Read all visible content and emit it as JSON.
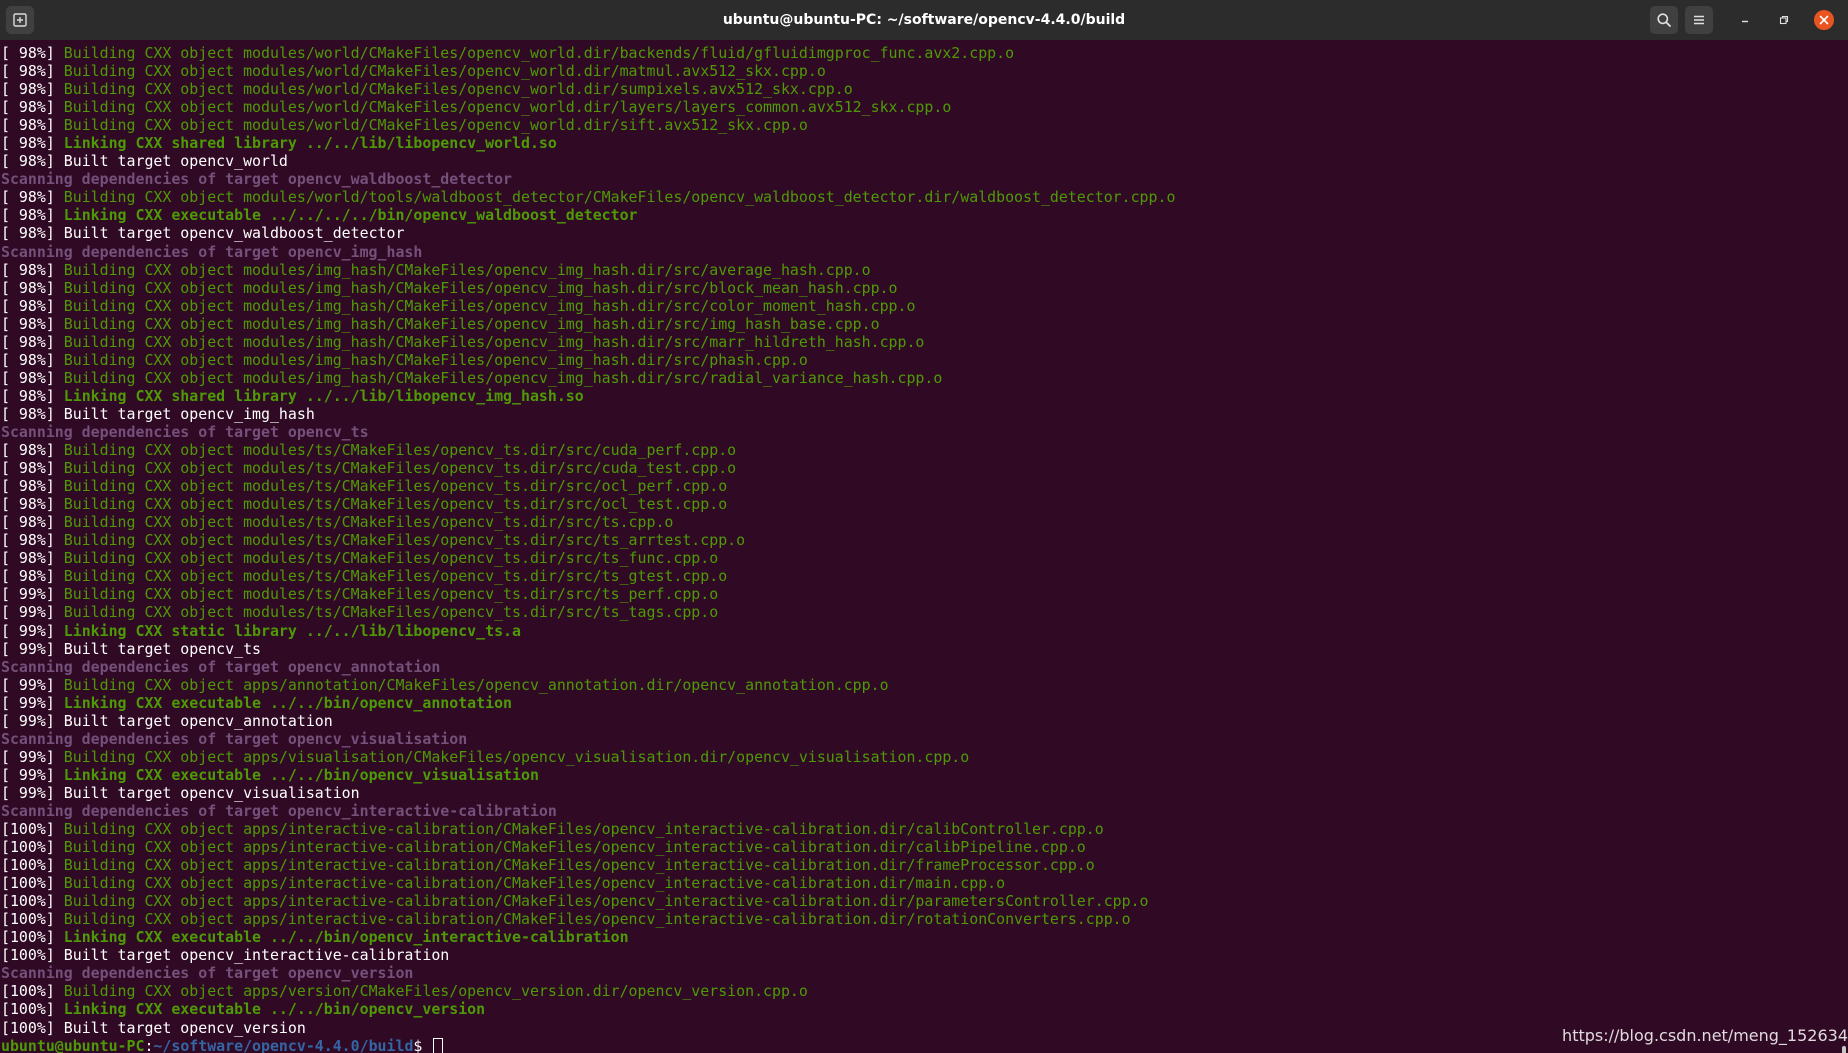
{
  "window": {
    "title": "ubuntu@ubuntu-PC: ~/software/opencv-4.4.0/build"
  },
  "titlebar_icons": {
    "new_tab": "new-tab-icon",
    "search": "search-icon",
    "menu": "hamburger-menu-icon",
    "minimize": "minimize-icon",
    "maximize": "maximize-icon",
    "close": "close-icon"
  },
  "colors": {
    "background": "#300a24",
    "titlebar": "#2c2c2c",
    "building": "#4e9a06",
    "scanning": "#75507b",
    "prompt_path": "#3465a4",
    "close_button": "#e95420"
  },
  "terminal": {
    "lines": [
      {
        "pct": "[ 98%]",
        "type": "building",
        "text": "Building CXX object modules/world/CMakeFiles/opencv_world.dir/backends/fluid/gfluidimgproc_func.avx2.cpp.o"
      },
      {
        "pct": "[ 98%]",
        "type": "building",
        "text": "Building CXX object modules/world/CMakeFiles/opencv_world.dir/matmul.avx512_skx.cpp.o"
      },
      {
        "pct": "[ 98%]",
        "type": "building",
        "text": "Building CXX object modules/world/CMakeFiles/opencv_world.dir/sumpixels.avx512_skx.cpp.o"
      },
      {
        "pct": "[ 98%]",
        "type": "building",
        "text": "Building CXX object modules/world/CMakeFiles/opencv_world.dir/layers/layers_common.avx512_skx.cpp.o"
      },
      {
        "pct": "[ 98%]",
        "type": "building",
        "text": "Building CXX object modules/world/CMakeFiles/opencv_world.dir/sift.avx512_skx.cpp.o"
      },
      {
        "pct": "[ 98%]",
        "type": "linking",
        "text": "Linking CXX shared library ../../lib/libopencv_world.so"
      },
      {
        "pct": "[ 98%]",
        "type": "built",
        "text": "Built target opencv_world"
      },
      {
        "pct": "",
        "type": "scanning",
        "text": "Scanning dependencies of target opencv_waldboost_detector"
      },
      {
        "pct": "[ 98%]",
        "type": "building",
        "text": "Building CXX object modules/world/tools/waldboost_detector/CMakeFiles/opencv_waldboost_detector.dir/waldboost_detector.cpp.o"
      },
      {
        "pct": "[ 98%]",
        "type": "linking",
        "text": "Linking CXX executable ../../../../bin/opencv_waldboost_detector"
      },
      {
        "pct": "[ 98%]",
        "type": "built",
        "text": "Built target opencv_waldboost_detector"
      },
      {
        "pct": "",
        "type": "scanning",
        "text": "Scanning dependencies of target opencv_img_hash"
      },
      {
        "pct": "[ 98%]",
        "type": "building",
        "text": "Building CXX object modules/img_hash/CMakeFiles/opencv_img_hash.dir/src/average_hash.cpp.o"
      },
      {
        "pct": "[ 98%]",
        "type": "building",
        "text": "Building CXX object modules/img_hash/CMakeFiles/opencv_img_hash.dir/src/block_mean_hash.cpp.o"
      },
      {
        "pct": "[ 98%]",
        "type": "building",
        "text": "Building CXX object modules/img_hash/CMakeFiles/opencv_img_hash.dir/src/color_moment_hash.cpp.o"
      },
      {
        "pct": "[ 98%]",
        "type": "building",
        "text": "Building CXX object modules/img_hash/CMakeFiles/opencv_img_hash.dir/src/img_hash_base.cpp.o"
      },
      {
        "pct": "[ 98%]",
        "type": "building",
        "text": "Building CXX object modules/img_hash/CMakeFiles/opencv_img_hash.dir/src/marr_hildreth_hash.cpp.o"
      },
      {
        "pct": "[ 98%]",
        "type": "building",
        "text": "Building CXX object modules/img_hash/CMakeFiles/opencv_img_hash.dir/src/phash.cpp.o"
      },
      {
        "pct": "[ 98%]",
        "type": "building",
        "text": "Building CXX object modules/img_hash/CMakeFiles/opencv_img_hash.dir/src/radial_variance_hash.cpp.o"
      },
      {
        "pct": "[ 98%]",
        "type": "linking",
        "text": "Linking CXX shared library ../../lib/libopencv_img_hash.so"
      },
      {
        "pct": "[ 98%]",
        "type": "built",
        "text": "Built target opencv_img_hash"
      },
      {
        "pct": "",
        "type": "scanning",
        "text": "Scanning dependencies of target opencv_ts"
      },
      {
        "pct": "[ 98%]",
        "type": "building",
        "text": "Building CXX object modules/ts/CMakeFiles/opencv_ts.dir/src/cuda_perf.cpp.o"
      },
      {
        "pct": "[ 98%]",
        "type": "building",
        "text": "Building CXX object modules/ts/CMakeFiles/opencv_ts.dir/src/cuda_test.cpp.o"
      },
      {
        "pct": "[ 98%]",
        "type": "building",
        "text": "Building CXX object modules/ts/CMakeFiles/opencv_ts.dir/src/ocl_perf.cpp.o"
      },
      {
        "pct": "[ 98%]",
        "type": "building",
        "text": "Building CXX object modules/ts/CMakeFiles/opencv_ts.dir/src/ocl_test.cpp.o"
      },
      {
        "pct": "[ 98%]",
        "type": "building",
        "text": "Building CXX object modules/ts/CMakeFiles/opencv_ts.dir/src/ts.cpp.o"
      },
      {
        "pct": "[ 98%]",
        "type": "building",
        "text": "Building CXX object modules/ts/CMakeFiles/opencv_ts.dir/src/ts_arrtest.cpp.o"
      },
      {
        "pct": "[ 98%]",
        "type": "building",
        "text": "Building CXX object modules/ts/CMakeFiles/opencv_ts.dir/src/ts_func.cpp.o"
      },
      {
        "pct": "[ 98%]",
        "type": "building",
        "text": "Building CXX object modules/ts/CMakeFiles/opencv_ts.dir/src/ts_gtest.cpp.o"
      },
      {
        "pct": "[ 99%]",
        "type": "building",
        "text": "Building CXX object modules/ts/CMakeFiles/opencv_ts.dir/src/ts_perf.cpp.o"
      },
      {
        "pct": "[ 99%]",
        "type": "building",
        "text": "Building CXX object modules/ts/CMakeFiles/opencv_ts.dir/src/ts_tags.cpp.o"
      },
      {
        "pct": "[ 99%]",
        "type": "linking",
        "text": "Linking CXX static library ../../lib/libopencv_ts.a"
      },
      {
        "pct": "[ 99%]",
        "type": "built",
        "text": "Built target opencv_ts"
      },
      {
        "pct": "",
        "type": "scanning",
        "text": "Scanning dependencies of target opencv_annotation"
      },
      {
        "pct": "[ 99%]",
        "type": "building",
        "text": "Building CXX object apps/annotation/CMakeFiles/opencv_annotation.dir/opencv_annotation.cpp.o"
      },
      {
        "pct": "[ 99%]",
        "type": "linking",
        "text": "Linking CXX executable ../../bin/opencv_annotation"
      },
      {
        "pct": "[ 99%]",
        "type": "built",
        "text": "Built target opencv_annotation"
      },
      {
        "pct": "",
        "type": "scanning",
        "text": "Scanning dependencies of target opencv_visualisation"
      },
      {
        "pct": "[ 99%]",
        "type": "building",
        "text": "Building CXX object apps/visualisation/CMakeFiles/opencv_visualisation.dir/opencv_visualisation.cpp.o"
      },
      {
        "pct": "[ 99%]",
        "type": "linking",
        "text": "Linking CXX executable ../../bin/opencv_visualisation"
      },
      {
        "pct": "[ 99%]",
        "type": "built",
        "text": "Built target opencv_visualisation"
      },
      {
        "pct": "",
        "type": "scanning",
        "text": "Scanning dependencies of target opencv_interactive-calibration"
      },
      {
        "pct": "[100%]",
        "type": "building",
        "text": "Building CXX object apps/interactive-calibration/CMakeFiles/opencv_interactive-calibration.dir/calibController.cpp.o"
      },
      {
        "pct": "[100%]",
        "type": "building",
        "text": "Building CXX object apps/interactive-calibration/CMakeFiles/opencv_interactive-calibration.dir/calibPipeline.cpp.o"
      },
      {
        "pct": "[100%]",
        "type": "building",
        "text": "Building CXX object apps/interactive-calibration/CMakeFiles/opencv_interactive-calibration.dir/frameProcessor.cpp.o"
      },
      {
        "pct": "[100%]",
        "type": "building",
        "text": "Building CXX object apps/interactive-calibration/CMakeFiles/opencv_interactive-calibration.dir/main.cpp.o"
      },
      {
        "pct": "[100%]",
        "type": "building",
        "text": "Building CXX object apps/interactive-calibration/CMakeFiles/opencv_interactive-calibration.dir/parametersController.cpp.o"
      },
      {
        "pct": "[100%]",
        "type": "building",
        "text": "Building CXX object apps/interactive-calibration/CMakeFiles/opencv_interactive-calibration.dir/rotationConverters.cpp.o"
      },
      {
        "pct": "[100%]",
        "type": "linking",
        "text": "Linking CXX executable ../../bin/opencv_interactive-calibration"
      },
      {
        "pct": "[100%]",
        "type": "built",
        "text": "Built target opencv_interactive-calibration"
      },
      {
        "pct": "",
        "type": "scanning",
        "text": "Scanning dependencies of target opencv_version"
      },
      {
        "pct": "[100%]",
        "type": "building",
        "text": "Building CXX object apps/version/CMakeFiles/opencv_version.dir/opencv_version.cpp.o"
      },
      {
        "pct": "[100%]",
        "type": "linking",
        "text": "Linking CXX executable ../../bin/opencv_version"
      },
      {
        "pct": "[100%]",
        "type": "built",
        "text": "Built target opencv_version"
      }
    ],
    "prompt": {
      "user_host": "ubuntu@ubuntu-PC",
      "separator": ":",
      "path": "~/software/opencv-4.4.0/build",
      "symbol": "$ "
    }
  },
  "watermark": {
    "text": "https://blog.csdn.net/meng_152634"
  }
}
